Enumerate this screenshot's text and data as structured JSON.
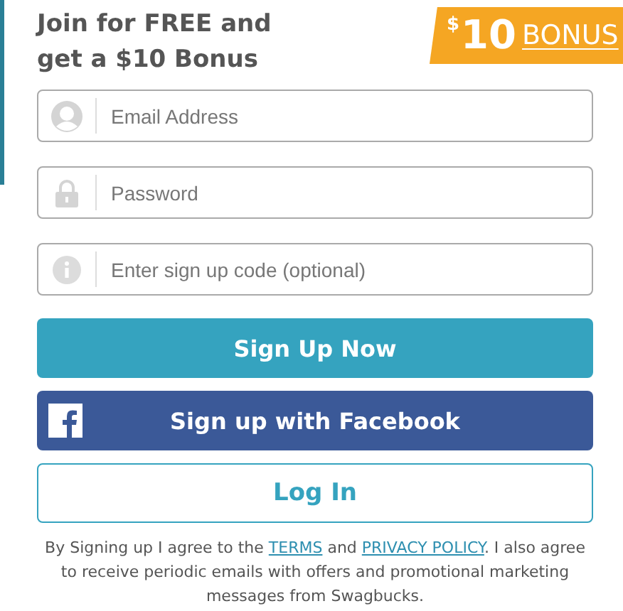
{
  "heading": {
    "line_1": "Join for FREE and",
    "line_2": "get a $10 Bonus"
  },
  "bonus_ribbon": {
    "currency": "$",
    "amount": "10",
    "label": "BONUS"
  },
  "fields": [
    {
      "kind": "email",
      "placeholder": "Email Address"
    },
    {
      "kind": "password",
      "placeholder": "Password"
    },
    {
      "kind": "code",
      "placeholder": "Enter sign up code (optional)"
    }
  ],
  "buttons": [
    {
      "kind": "primary",
      "label": "Sign Up Now"
    },
    {
      "kind": "facebook",
      "label": "Sign up with Facebook"
    },
    {
      "kind": "outline",
      "label": "Log In"
    }
  ],
  "legal": {
    "before": "By Signing up I agree to the",
    "terms": "TERMS",
    "middle": "and",
    "privacy": "PRIVACY POLICY",
    "after": ". I also agree to receive periodic emails with offers and promotional marketing messages from Swagbucks."
  }
}
